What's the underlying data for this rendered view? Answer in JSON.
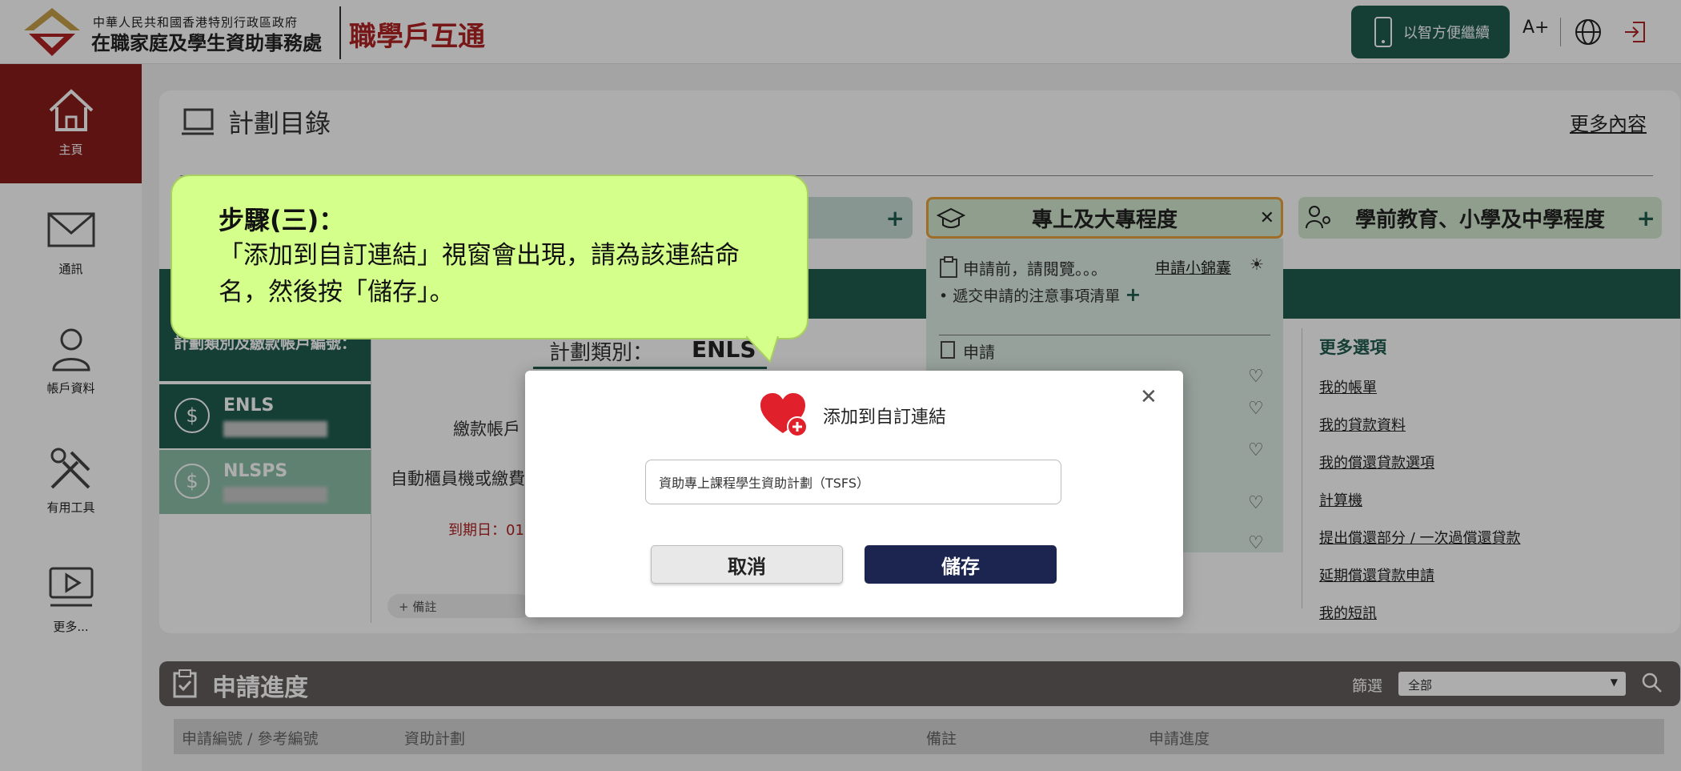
{
  "header": {
    "dept_small": "中華人民共和國香港特別行政區政府",
    "dept_big": "在職家庭及學生資助事務處",
    "brand": "職學戶互通",
    "mobile_continue": "以智方便繼續",
    "font_size_label": "A+",
    "colors": {
      "brand_red": "#b22222",
      "primary_green": "#1f5c4e"
    }
  },
  "sidebar": {
    "items": [
      {
        "label": "主頁",
        "icon": "home-icon"
      },
      {
        "label": "通訊",
        "icon": "mail-icon"
      },
      {
        "label": "帳戶資料",
        "icon": "user-icon"
      },
      {
        "label": "有用工具",
        "icon": "tools-icon"
      },
      {
        "label": "更多...",
        "icon": "video-icon"
      }
    ]
  },
  "catalog": {
    "title": "計劃目錄",
    "more_link": "更多內容",
    "tabs": [
      {
        "label": "專上及大專程度"
      },
      {
        "label": "學前教育、小學及中學程度"
      }
    ],
    "apply_before": "申請前，請閱覽。。。",
    "apply_tips": "申請小錦囊",
    "checklist": "遞交申請的注意事項清單",
    "apply": "申請",
    "scheme_type_label": "計劃類別：",
    "scheme_type_value": "ENLS",
    "account_header": "計劃類別及繳款帳戶編號：",
    "accounts": [
      {
        "name": "ENLS"
      },
      {
        "name": "NLSPS"
      }
    ],
    "payment_account": "繳款帳戶",
    "atm_label": "自動櫃員機或繳費",
    "due_date": "到期日：01",
    "remark_add": "備註",
    "more_options_title": "更多選項",
    "more_options": [
      "我的帳單",
      "我的貸款資料",
      "我的償還貸款選項",
      "計算機",
      "提出償還部分 / 一次過償還貸款",
      "延期償還貸款申請",
      "我的短訊"
    ]
  },
  "bubble": {
    "title": "步驟(三)：",
    "body": "「添加到自訂連結」視窗會出現，請為該連結命名，然後按「儲存」。"
  },
  "modal": {
    "title": "添加到自訂連結",
    "input_value": "資助專上課程學生資助計劃（TSFS）",
    "cancel": "取消",
    "save": "儲存"
  },
  "progress": {
    "title": "申請進度",
    "filter_label": "篩選",
    "filter_value": "全部",
    "columns": [
      "申請編號 / 參考編號",
      "資助計劃",
      "備註",
      "申請進度"
    ]
  }
}
